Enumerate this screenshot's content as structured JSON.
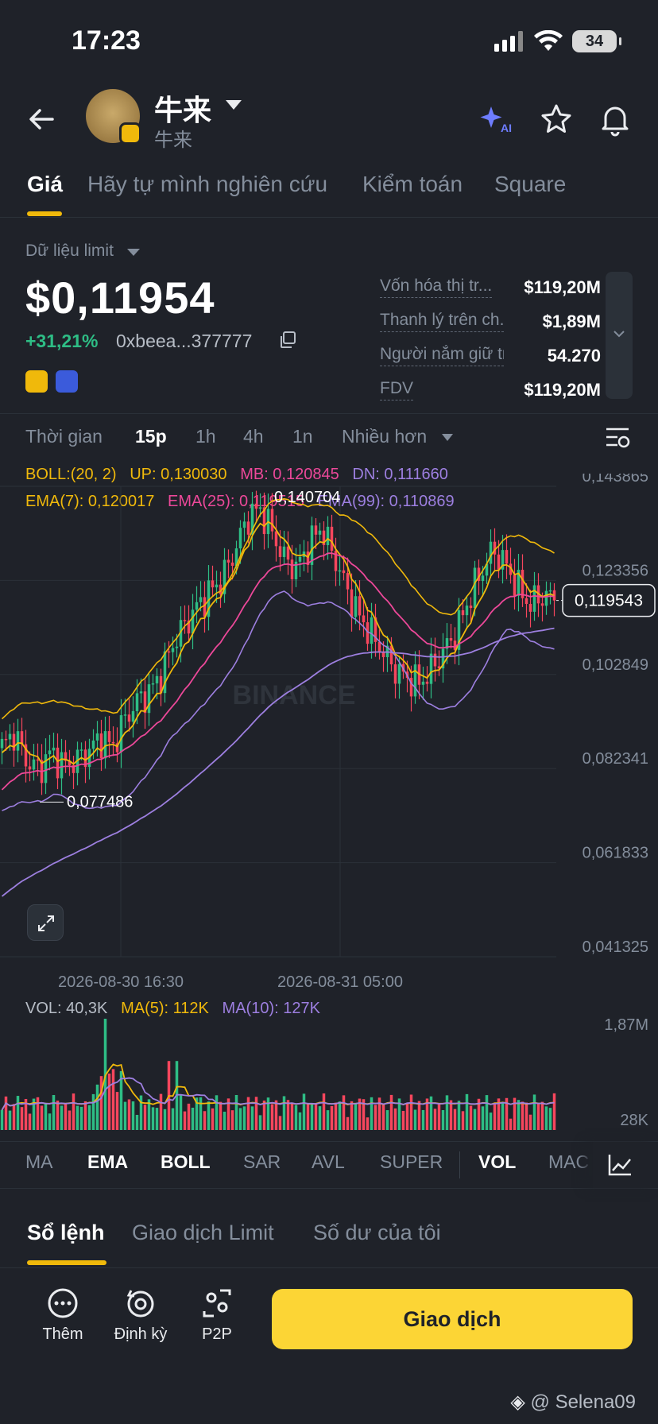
{
  "status": {
    "time": "17:23",
    "battery": "34"
  },
  "header": {
    "title": "牛来",
    "subtitle": "牛来",
    "ai_label": "AI"
  },
  "tabs": [
    {
      "label": "Giá"
    },
    {
      "label": "Hãy tự mình nghiên cứu"
    },
    {
      "label": "Kiểm toán"
    },
    {
      "label": "Square"
    }
  ],
  "price_section": {
    "data_source": "Dữ liệu limit",
    "price": "$0,11954",
    "change": "+31,21%",
    "address": "0xbeea...377777"
  },
  "stats": [
    {
      "label": "Vốn hóa thị tr...",
      "value": "$119,20M"
    },
    {
      "label": "Thanh lý trên ch...",
      "value": "$1,89M"
    },
    {
      "label": "Người nắm giữ tr...",
      "value": "54.270"
    },
    {
      "label": "FDV",
      "value": "$119,20M"
    }
  ],
  "timebar": {
    "items": [
      "Thời gian",
      "15p",
      "1h",
      "4h",
      "1n",
      "Nhiều hơn"
    ],
    "active": "15p"
  },
  "indicators": {
    "boll": "BOLL:(20, 2)",
    "up": "UP: 0,130030",
    "mb": "MB: 0,120845",
    "dn": "DN: 0,111660",
    "ema7": "EMA(7): 0,120017",
    "ema25": "EMA(25): 0,119515",
    "ema99": "EMA(99): 0,110869"
  },
  "colors": {
    "up": "#2ebd85",
    "down": "#f6465d",
    "yellow": "#f0b90b",
    "pink": "#ec4899",
    "purple": "#9d7fe0",
    "accent": "#fcd535"
  },
  "chart_data": {
    "type": "candlestick",
    "y_ticks": [
      "0,143865",
      "0,123356",
      "0,102849",
      "0,082341",
      "0,061833",
      "0,041325"
    ],
    "ylim": [
      0.041325,
      0.143865
    ],
    "x_ticks": [
      "2026-08-30 16:30",
      "2026-08-31 05:00"
    ],
    "high_label": "0,140704",
    "low_label": "0,077486",
    "current_price": "0,119543",
    "watermark": "BINANCE",
    "close_path": [
      0.087,
      0.09,
      0.084,
      0.082,
      0.086,
      0.083,
      0.084,
      0.086,
      0.089,
      0.087,
      0.093,
      0.097,
      0.099,
      0.103,
      0.11,
      0.114,
      0.118,
      0.121,
      0.124,
      0.13,
      0.137,
      0.139,
      0.134,
      0.128,
      0.126,
      0.131,
      0.135,
      0.129,
      0.122,
      0.116,
      0.112,
      0.108,
      0.104,
      0.102,
      0.101,
      0.104,
      0.108,
      0.112,
      0.119,
      0.125,
      0.13,
      0.127,
      0.122,
      0.118,
      0.12,
      0.119543
    ]
  },
  "volume": {
    "vol": "VOL: 40,3K",
    "ma5": "MA(5): 112K",
    "ma10": "MA(10): 127K",
    "ticks": [
      "1,87M",
      "28K"
    ]
  },
  "indicator_tabs": [
    "MA",
    "EMA",
    "BOLL",
    "SAR",
    "AVL",
    "SUPER",
    "VOL",
    "MAC"
  ],
  "book_tabs": [
    "Sổ lệnh",
    "Giao dịch Limit",
    "Số dư của tôi"
  ],
  "bottom": {
    "more": "Thêm",
    "periodic": "Định kỳ",
    "p2p": "P2P",
    "trade": "Giao dịch"
  },
  "footer": {
    "watermark": "@ Selena09"
  }
}
